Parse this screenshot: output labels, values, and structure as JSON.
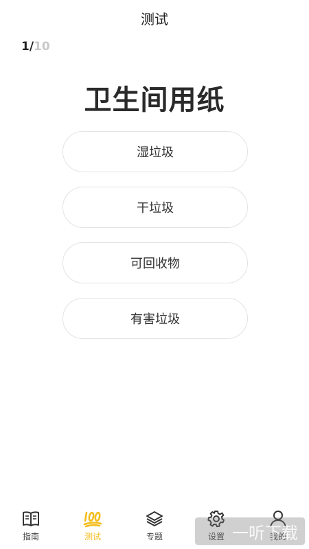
{
  "header": {
    "title": "测试"
  },
  "progress": {
    "current": "1/",
    "total": "10"
  },
  "question": {
    "text": "卫生间用纸"
  },
  "options": [
    {
      "label": "湿垃圾"
    },
    {
      "label": "干垃圾"
    },
    {
      "label": "可回收物"
    },
    {
      "label": "有害垃圾"
    }
  ],
  "tabbar": {
    "active_color": "#f3bd1c",
    "items": [
      {
        "label": "指南",
        "icon": "book-icon"
      },
      {
        "label": "测试",
        "icon": "hundred-points-icon"
      },
      {
        "label": "专题",
        "icon": "layers-icon"
      },
      {
        "label": "设置",
        "icon": "gear-icon"
      },
      {
        "label": "我的",
        "icon": "user-icon"
      }
    ]
  },
  "watermark": {
    "text": "一听下载"
  }
}
